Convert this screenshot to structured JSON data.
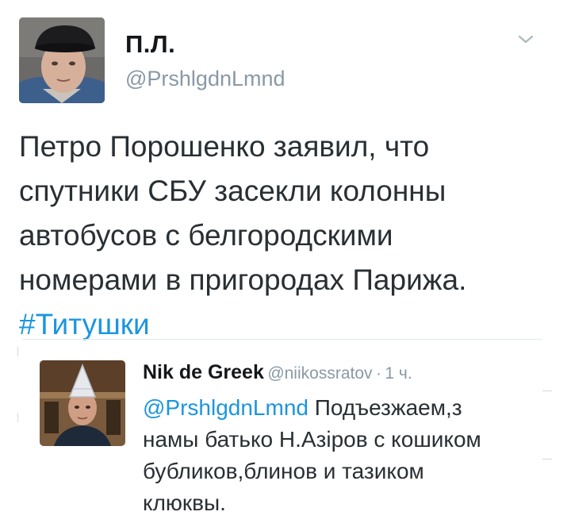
{
  "tweet": {
    "author_name": "П.Л.",
    "author_handle": "@PrshlgdnLmnd",
    "text_lines": [
      "Петро Порошенко заявил, что",
      "спутники СБУ засекли колонны",
      "автобусов с белгородскими",
      "номерами в пригородах Парижа."
    ],
    "hashtag": "#Титушки"
  },
  "reply": {
    "author_name": "Nik de Greek",
    "author_handle": "@niikossratov",
    "separator": "·",
    "time": "1 ч.",
    "mention": "@PrshlgdnLmnd",
    "text_lines": [
      " Подъезжаем,з",
      "намы батько Н.Азіров с кошиком",
      "бубликов,блинов и тазиком",
      "клюквы."
    ]
  },
  "icons": {
    "menu": "chevron-down-icon"
  },
  "colors": {
    "link": "#1b95e0",
    "secondary_text": "#8899a6",
    "primary_text": "#292f33"
  }
}
